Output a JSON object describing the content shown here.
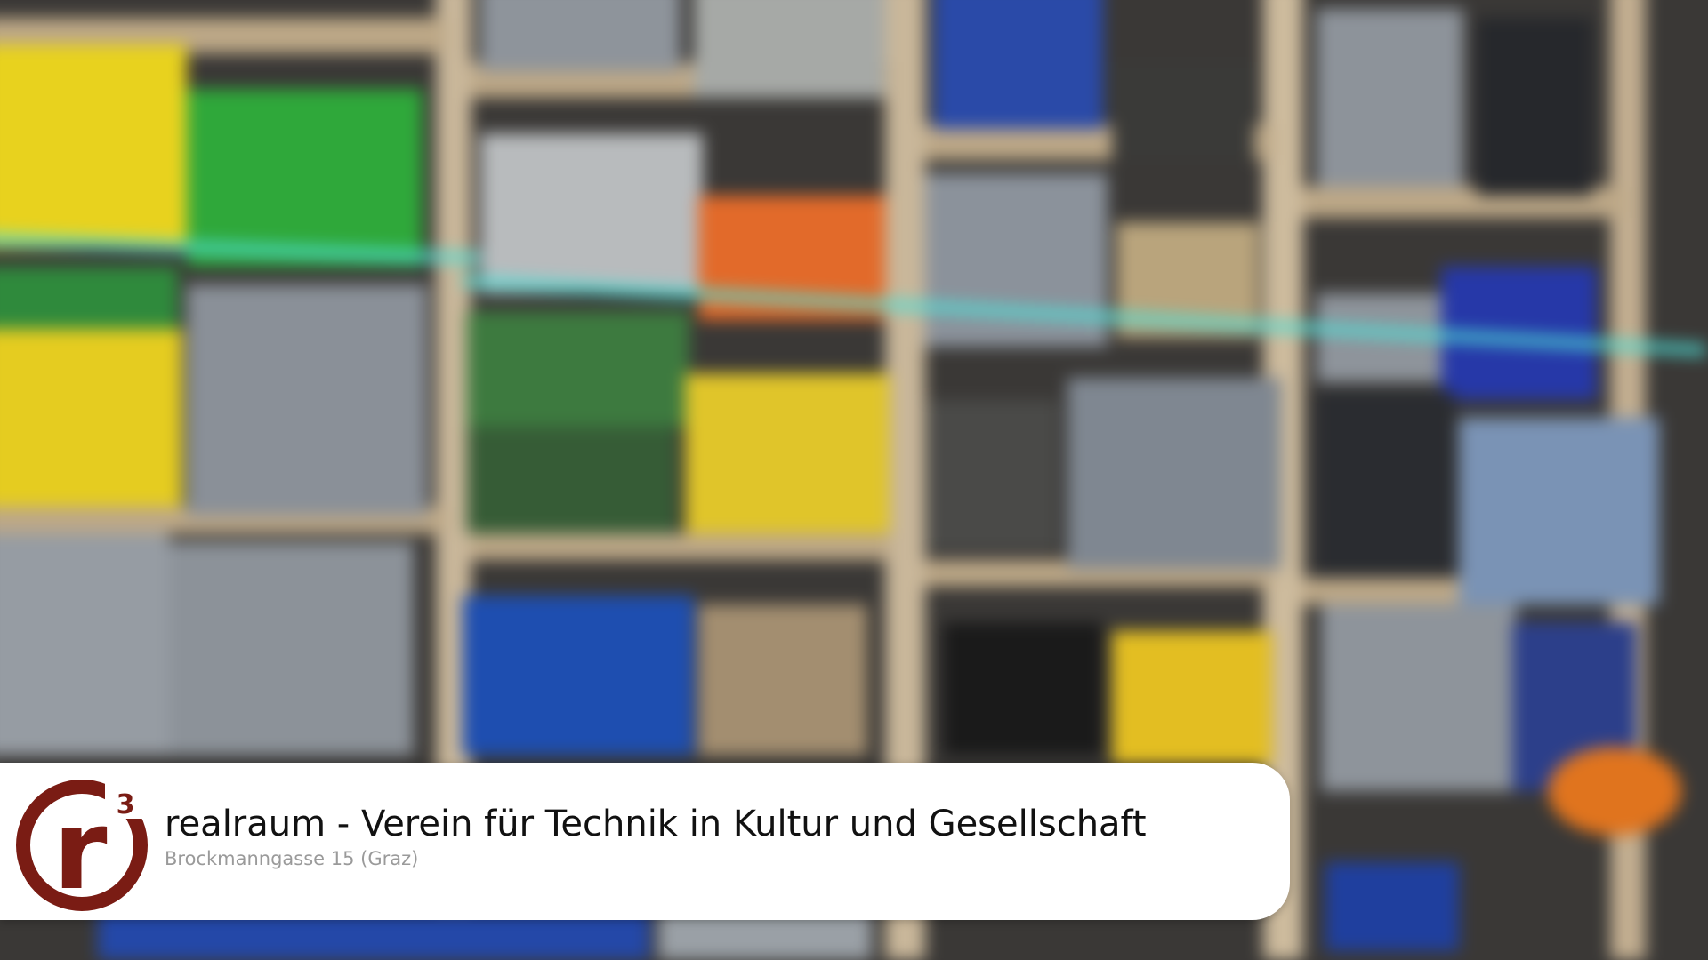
{
  "card": {
    "title": "realraum - Verein für Technik in Kultur und Gesellschaft",
    "subtitle": "Brockmanngasse 15 (Graz)"
  },
  "logo": {
    "letter": "r",
    "superscript": "3"
  },
  "colors": {
    "logo_red": "#7a1c14",
    "card_background": "#ffffff",
    "title_text": "#111111",
    "subtitle_text": "#9a9a9a"
  }
}
